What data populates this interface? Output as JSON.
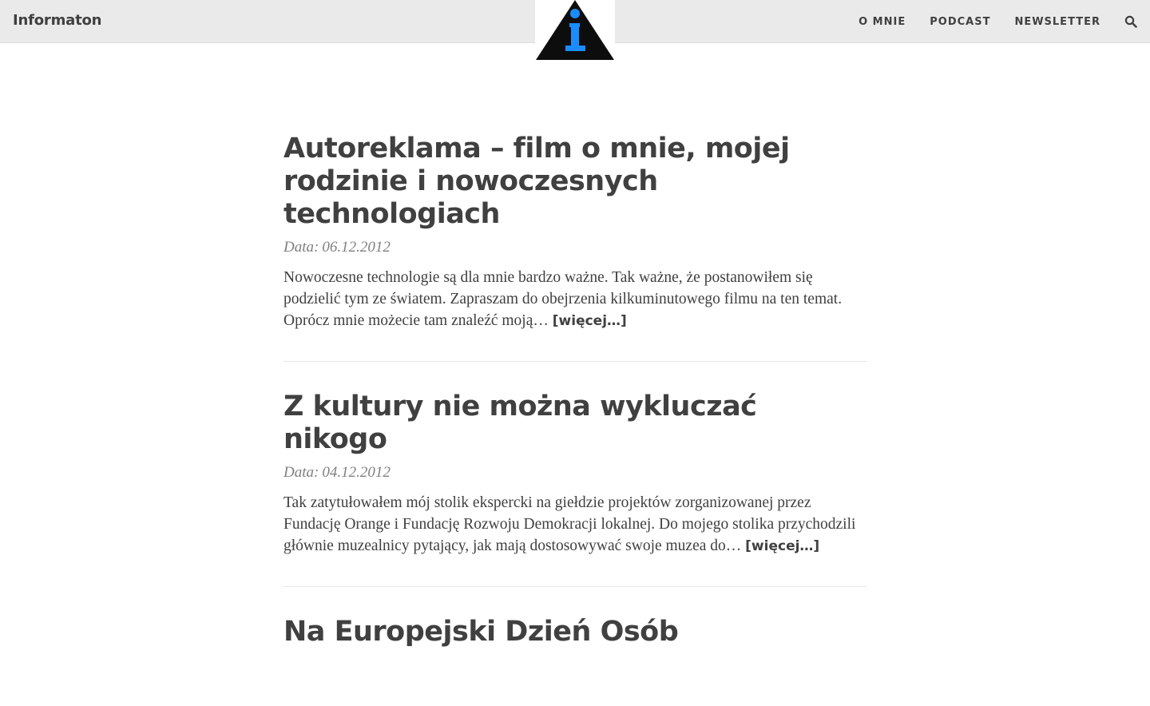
{
  "header": {
    "brand": "Informaton",
    "logo_icon": "info-triangle-icon",
    "nav": [
      {
        "label": "O MNIE"
      },
      {
        "label": "PODCAST"
      },
      {
        "label": "NEWSLETTER"
      }
    ],
    "search_icon": "search-icon"
  },
  "posts": [
    {
      "title": "Autoreklama – film o mnie, mojej rodzinie i nowoczesnych technologiach",
      "date_label": "Data:",
      "date": "06.12.2012",
      "excerpt": "Nowoczesne technologie są dla mnie bardzo ważne. Tak ważne, że postanowiłem się podzielić tym ze światem. Zapraszam do obejrzenia kilkuminutowego filmu na ten temat. Oprócz mnie możecie tam znaleźć moją…",
      "more": "[więcej…]"
    },
    {
      "title": "Z kultury nie można wykluczać nikogo",
      "date_label": "Data:",
      "date": "04.12.2012",
      "excerpt": "Tak zatytułowałem mój stolik ekspercki na giełdzie projektów zorganizowanej przez Fundację Orange i Fundację Rozwoju Demokracji lokalnej. Do mojego stolika przychodzili głównie muzealnicy pytający, jak mają dostosowywać swoje muzea do…",
      "more": "[więcej…]"
    },
    {
      "title": "Na Europejski Dzień Osób"
    }
  ],
  "colors": {
    "header_bg": "#eaeaea",
    "text": "#404040",
    "date": "#808080",
    "logo_accent": "#1a8cff"
  }
}
